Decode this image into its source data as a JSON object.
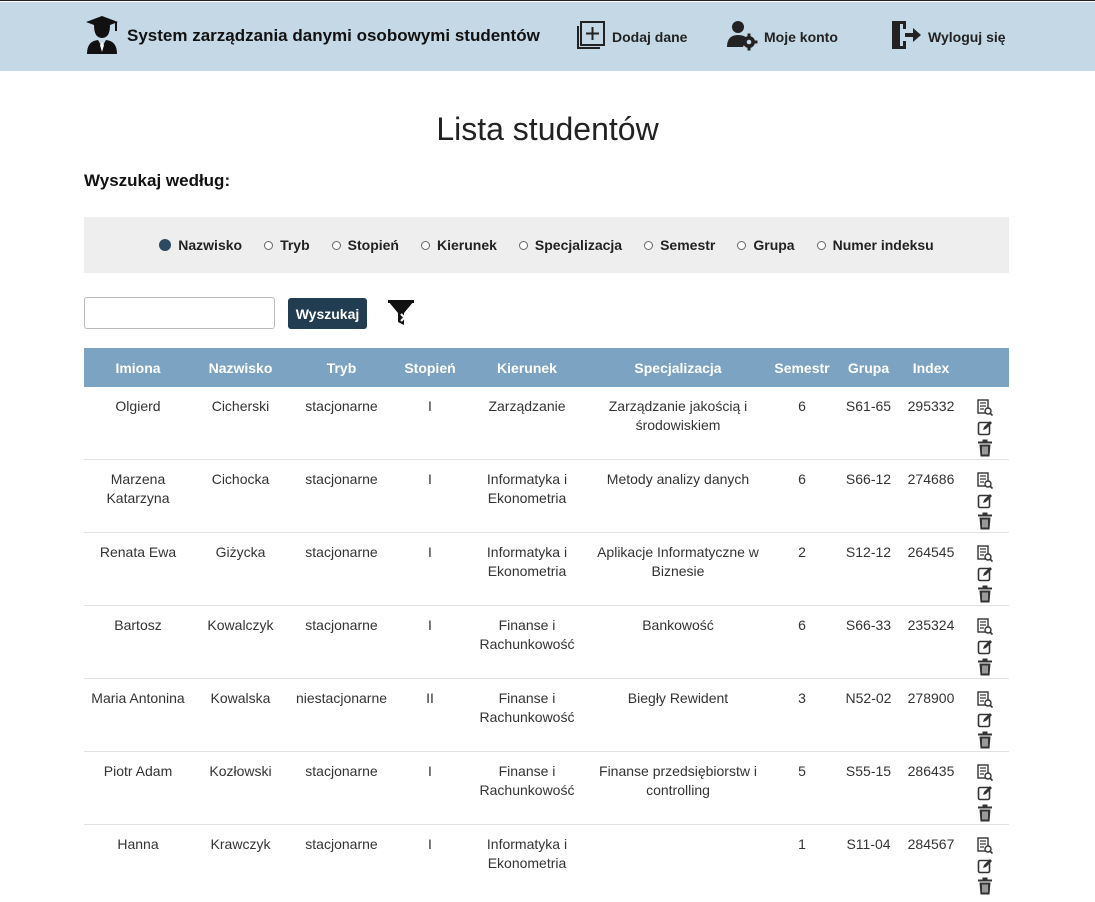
{
  "header": {
    "app_title": "System zarządzania danymi osobowymi studentów",
    "nav": {
      "add": "Dodaj dane",
      "account": "Moje konto",
      "logout": "Wyloguj się"
    }
  },
  "page": {
    "title": "Lista studentów",
    "search_label": "Wyszukaj według:"
  },
  "search": {
    "options": [
      "Nazwisko",
      "Tryb",
      "Stopień",
      "Kierunek",
      "Specjalizacja",
      "Semestr",
      "Grupa",
      "Numer indeksu"
    ],
    "selected": "Nazwisko",
    "value": "",
    "button": "Wyszukaj"
  },
  "table": {
    "columns": [
      "Imiona",
      "Nazwisko",
      "Tryb",
      "Stopień",
      "Kierunek",
      "Specjalizacja",
      "Semestr",
      "Grupa",
      "Index",
      ""
    ],
    "rows": [
      {
        "imiona": "Olgierd",
        "nazwisko": "Cicherski",
        "tryb": "stacjonarne",
        "stopien": "I",
        "kierunek": "Zarządzanie",
        "specjalizacja": "Zarządzanie jakością i środowiskiem",
        "semestr": "6",
        "grupa": "S61-65",
        "index": "295332"
      },
      {
        "imiona": "Marzena Katarzyna",
        "nazwisko": "Cichocka",
        "tryb": "stacjonarne",
        "stopien": "I",
        "kierunek": "Informatyka i Ekonometria",
        "specjalizacja": "Metody analizy danych",
        "semestr": "6",
        "grupa": "S66-12",
        "index": "274686"
      },
      {
        "imiona": "Renata Ewa",
        "nazwisko": "Giżycka",
        "tryb": "stacjonarne",
        "stopien": "I",
        "kierunek": "Informatyka i Ekonometria",
        "specjalizacja": "Aplikacje Informatyczne w Biznesie",
        "semestr": "2",
        "grupa": "S12-12",
        "index": "264545"
      },
      {
        "imiona": "Bartosz",
        "nazwisko": "Kowalczyk",
        "tryb": "stacjonarne",
        "stopien": "I",
        "kierunek": "Finanse i Rachunkowość",
        "specjalizacja": "Bankowość",
        "semestr": "6",
        "grupa": "S66-33",
        "index": "235324"
      },
      {
        "imiona": "Maria Antonina",
        "nazwisko": "Kowalska",
        "tryb": "niestacjonarne",
        "stopien": "II",
        "kierunek": "Finanse i Rachunkowość",
        "specjalizacja": "Biegły Rewident",
        "semestr": "3",
        "grupa": "N52-02",
        "index": "278900"
      },
      {
        "imiona": "Piotr Adam",
        "nazwisko": "Kozłowski",
        "tryb": "stacjonarne",
        "stopien": "I",
        "kierunek": "Finanse i Rachunkowość",
        "specjalizacja": "Finanse przedsiębiorstw i controlling",
        "semestr": "5",
        "grupa": "S55-15",
        "index": "286435"
      },
      {
        "imiona": "Hanna",
        "nazwisko": "Krawczyk",
        "tryb": "stacjonarne",
        "stopien": "I",
        "kierunek": "Informatyka i Ekonometria",
        "specjalizacja": "",
        "semestr": "1",
        "grupa": "S11-04",
        "index": "284567"
      }
    ]
  },
  "icons": {
    "brand": "graduate-icon",
    "add": "add-square-icon",
    "account": "user-gear-icon",
    "logout": "logout-door-icon",
    "filter_clear": "filter-clear-icon",
    "row_actions": [
      "view-details-icon",
      "edit-icon",
      "trash-icon"
    ]
  },
  "colors": {
    "header_bg": "#c5d8e6",
    "table_header_bg": "#7ca3c1",
    "button_bg": "#223c52",
    "radio_checked": "#2d4a63"
  }
}
